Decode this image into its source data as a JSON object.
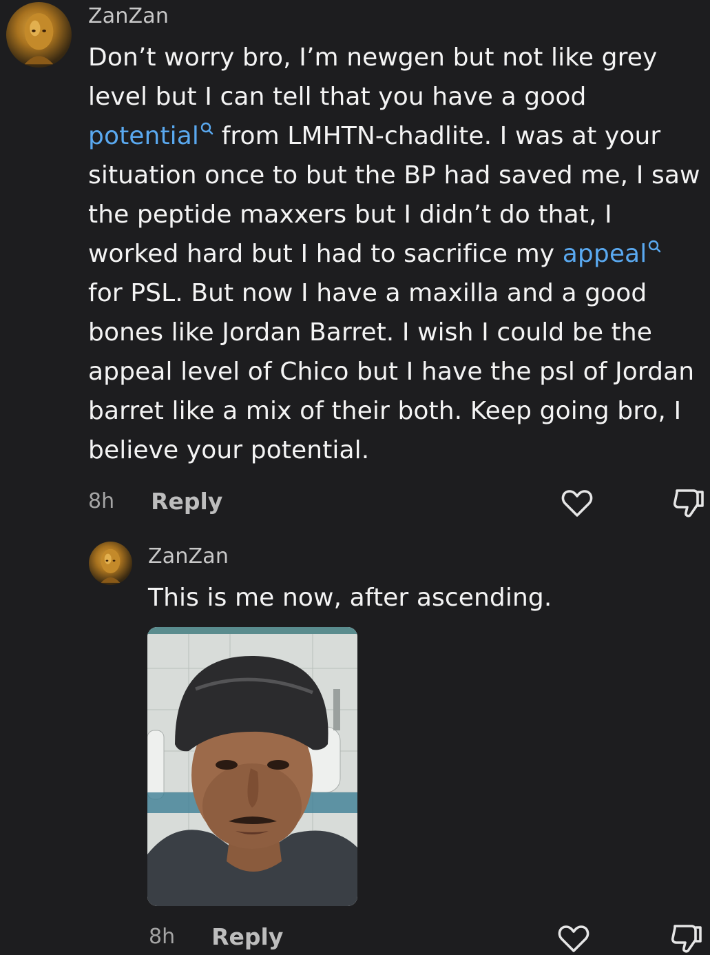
{
  "comments": [
    {
      "username": "ZanZan",
      "text_parts": [
        {
          "type": "text",
          "value": "Don’t worry bro, I’m newgen but not like grey level but I can tell that you have a good "
        },
        {
          "type": "link",
          "value": "potential"
        },
        {
          "type": "text",
          "value": " from LMHTN-chadlite. I was at your situation once to but the BP had saved me, I saw the peptide maxxers but I didn’t do that, I worked hard but I had to sacrifice my "
        },
        {
          "type": "link",
          "value": "appeal"
        },
        {
          "type": "text",
          "value": " for PSL. But now I have a maxilla and a good bones like Jordan Barret. I wish I could be the appeal level of Chico but I have the psl of Jordan barret like a mix of their both. Keep going bro, I believe your potential."
        }
      ],
      "time": "8h",
      "reply_label": "Reply"
    },
    {
      "username": "ZanZan",
      "text": "This is me now, after ascending.",
      "time": "8h",
      "reply_label": "Reply"
    }
  ],
  "colors": {
    "background": "#1d1d1f",
    "link": "#5aa9f0",
    "text": "#f4f4f4",
    "muted": "#a5a5a5"
  },
  "icons": {
    "link_search": "search-icon",
    "like": "heart-icon",
    "dislike": "thumbs-down-icon"
  }
}
